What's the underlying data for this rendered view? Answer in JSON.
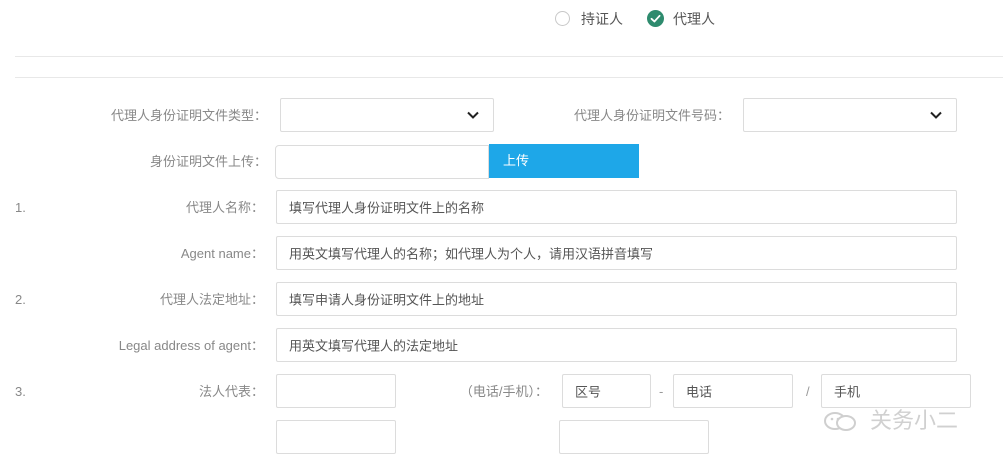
{
  "radio_group": {
    "options": [
      {
        "label": "持证人",
        "checked": false
      },
      {
        "label": "代理人",
        "checked": true
      }
    ]
  },
  "doc_type": {
    "label": "代理人身份证明文件类型：",
    "value": ""
  },
  "doc_number": {
    "label": "代理人身份证明文件号码：",
    "value": ""
  },
  "upload": {
    "label": "身份证明文件上传：",
    "button": "上传"
  },
  "fields": [
    {
      "number": "1.",
      "label": "代理人名称：",
      "placeholder": "填写代理人身份证明文件上的名称"
    },
    {
      "number": "",
      "label": "Agent name：",
      "placeholder": "用英文填写代理人的名称；如代理人为个人，请用汉语拼音填写"
    },
    {
      "number": "2.",
      "label": "代理人法定地址：",
      "placeholder": "填写申请人身份证明文件上的地址"
    },
    {
      "number": "",
      "label": "Legal address of agent：",
      "placeholder": "用英文填写代理人的法定地址"
    }
  ],
  "legal_rep": {
    "number": "3.",
    "label": "法人代表：",
    "phone_label": "（电话/手机）：",
    "area_code_placeholder": "区号",
    "dash": "-",
    "phone_placeholder": "电话",
    "slash": "/",
    "mobile_placeholder": "手机"
  },
  "watermark": {
    "text": "关务小二"
  },
  "colors": {
    "accent_green": "#2e8b6e",
    "upload_blue": "#1ea7e8"
  }
}
